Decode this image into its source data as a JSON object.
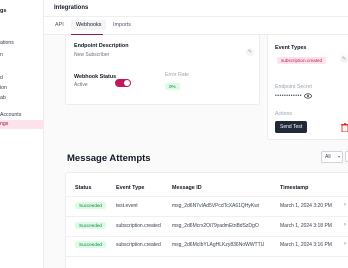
{
  "sidebar": {
    "brand": "gs",
    "items": [
      {
        "label": "ations"
      },
      {
        "label": "n"
      },
      {
        "label": "d"
      },
      {
        "label": "ion"
      },
      {
        "label": "ab"
      },
      {
        "label": "Accounts"
      },
      {
        "label": "ngs"
      }
    ]
  },
  "header": {
    "title": "Integrations"
  },
  "tabs": [
    {
      "label": "API"
    },
    {
      "label": "Webhooks"
    },
    {
      "label": "Imports"
    }
  ],
  "endpoint": {
    "desc_label": "Endpoint Description",
    "desc_value": "New Subscriber",
    "status_label": "Webhook Status",
    "status_value": "Active",
    "error_label": "Error Rate",
    "error_value": "0%"
  },
  "side_card": {
    "event_types_label": "Event Types",
    "event_type_tag": "subscription.created",
    "secret_label": "Endpoint Secret",
    "secret_value": "••••••••••••",
    "actions_label": "Actions",
    "send_test": "Send Test"
  },
  "attempts": {
    "title": "Message Attempts",
    "filter_value": "All",
    "columns": [
      "Status",
      "Event Type",
      "Message ID",
      "Timestamp"
    ],
    "rows": [
      {
        "status": "Succeeded",
        "event": "test.event",
        "id": "msg_2d6N7vIAd5VPcdTcXA61QHyKwi",
        "time": "March 1, 2024 3:20 PM"
      },
      {
        "status": "Succeeded",
        "event": "subscription.created",
        "id": "msg_2d6Mcrx2Oi79yadmEtnBdSzDgO",
        "time": "March 1, 2024 3:18 PM"
      },
      {
        "status": "Succeeded",
        "event": "subscription.created",
        "id": "msg_2d6McIbYLAgHLKzy836NoWWTTU",
        "time": "March 1, 2024 3:16 PM"
      }
    ]
  },
  "colors": {
    "accent": "#9d174d",
    "toggle_on": "#c2185b",
    "success_bg": "#dcfce7",
    "success_fg": "#15803d",
    "danger": "#dc2626"
  }
}
